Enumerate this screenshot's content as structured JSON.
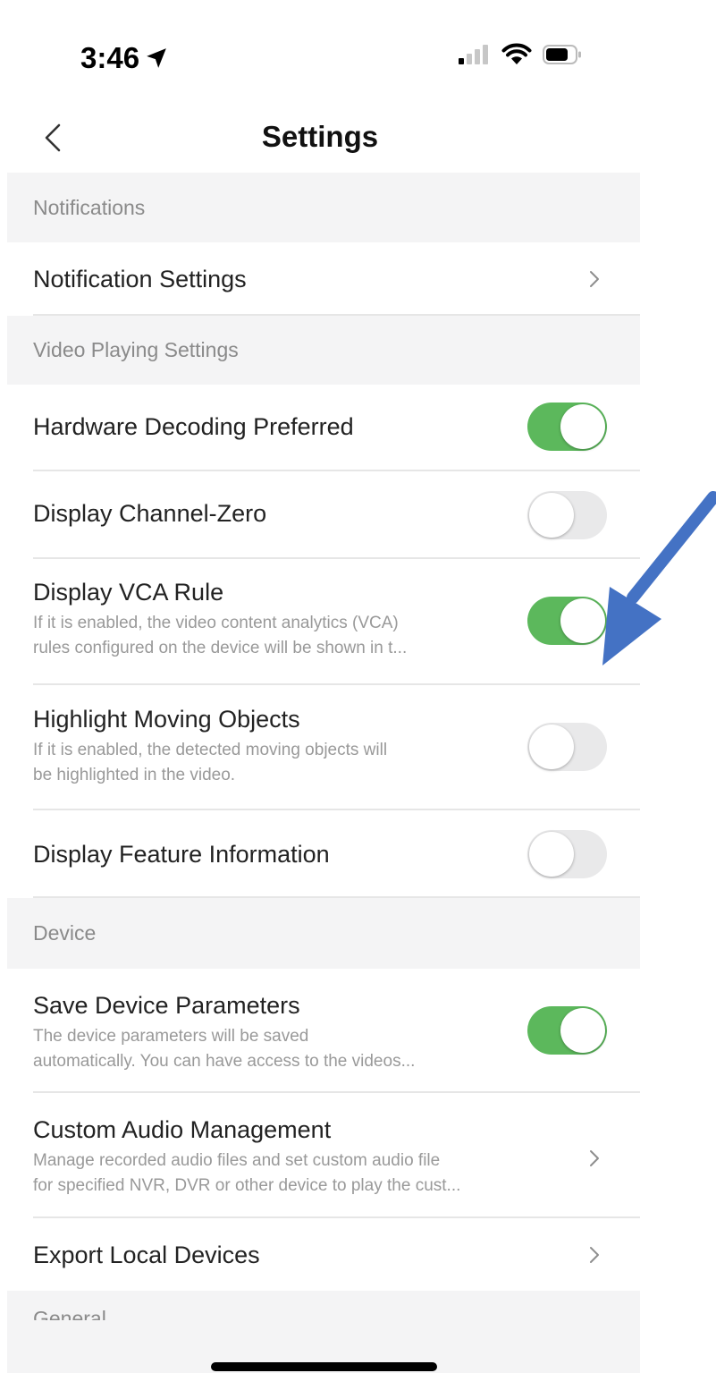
{
  "status_bar": {
    "time": "3:46"
  },
  "nav": {
    "title": "Settings"
  },
  "sections": {
    "notifications": {
      "header": "Notifications",
      "items": [
        {
          "title": "Notification Settings",
          "type": "link"
        }
      ]
    },
    "video": {
      "header": "Video Playing Settings",
      "items": [
        {
          "title": "Hardware Decoding Preferred",
          "type": "toggle",
          "state": "on"
        },
        {
          "title": "Display Channel-Zero",
          "type": "toggle",
          "state": "off"
        },
        {
          "title": "Display VCA Rule",
          "desc1": "If it is enabled, the video content analytics (VCA)",
          "desc2": "rules configured on the device will be shown in t...",
          "type": "toggle",
          "state": "on"
        },
        {
          "title": "Highlight Moving Objects",
          "desc1": "If it is enabled, the detected moving objects will",
          "desc2": "be highlighted in the video.",
          "type": "toggle",
          "state": "off"
        },
        {
          "title": "Display Feature Information",
          "type": "toggle",
          "state": "off"
        }
      ]
    },
    "device": {
      "header": "Device",
      "items": [
        {
          "title": "Save Device Parameters",
          "desc1": "The device parameters will be saved",
          "desc2": "automatically. You can have access to the videos...",
          "type": "toggle",
          "state": "on"
        },
        {
          "title": "Custom Audio Management",
          "desc1": "Manage recorded audio files and set custom audio file",
          "desc2": "for specified NVR, DVR or other device to play the cust...",
          "type": "link"
        },
        {
          "title": "Export Local Devices",
          "type": "link"
        }
      ]
    },
    "general": {
      "header": "General"
    }
  },
  "colors": {
    "toggle_on": "#5cb85c",
    "toggle_off": "#e9e9ea",
    "annotation_arrow": "#4472c4",
    "section_bg": "#f4f4f5"
  }
}
